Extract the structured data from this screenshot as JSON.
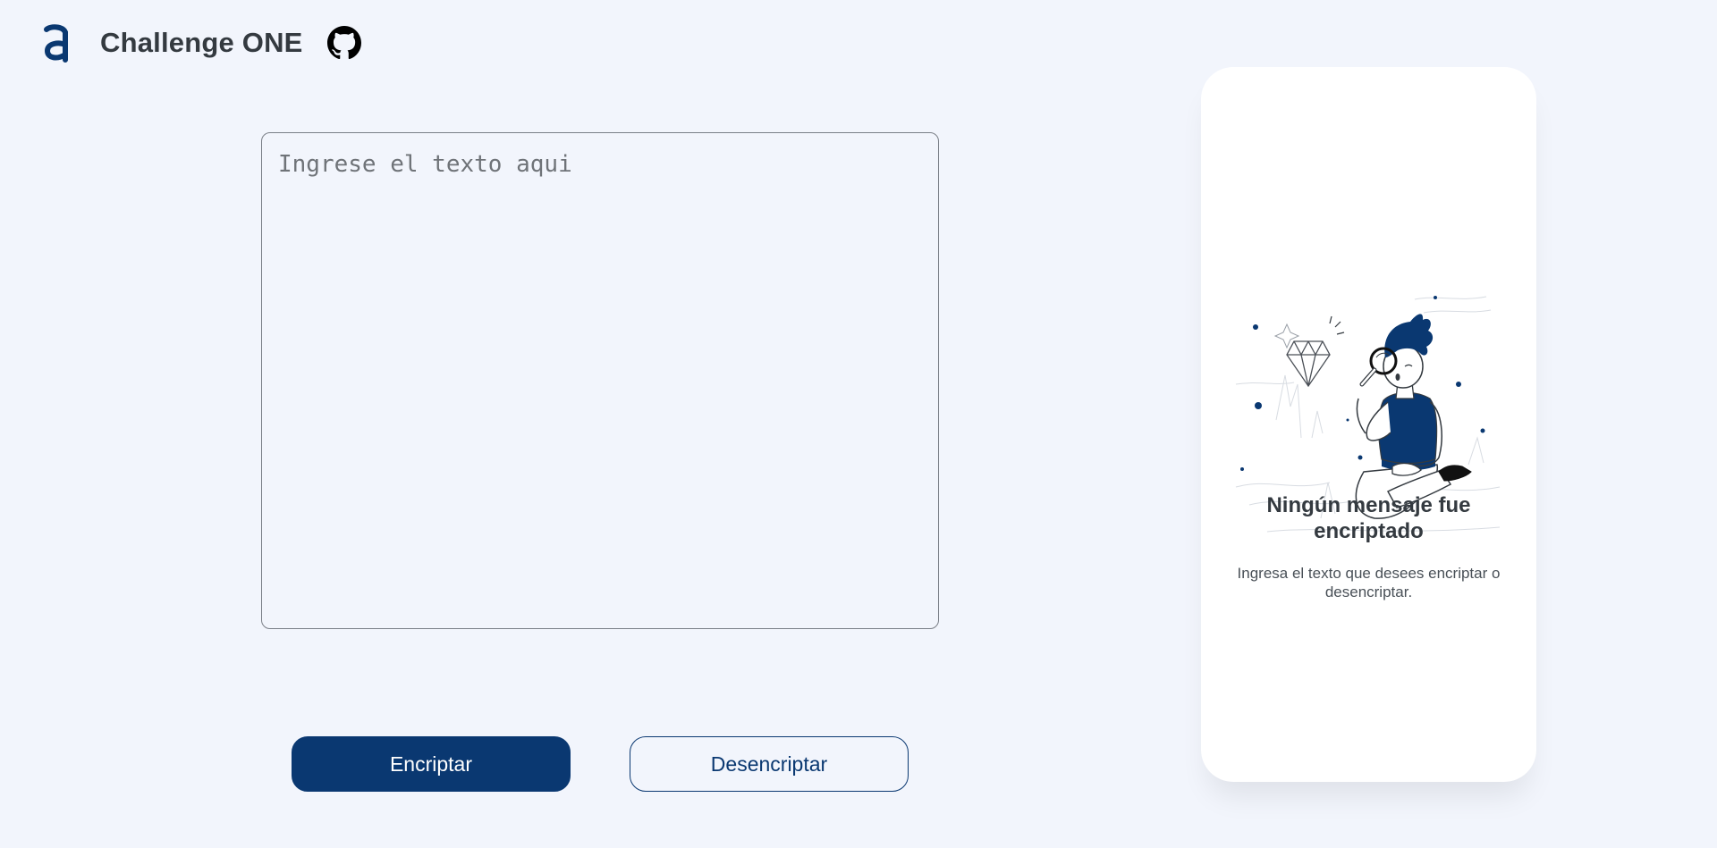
{
  "header": {
    "title": "Challenge ONE",
    "logo_icon": "alura-logo-icon",
    "github_icon": "github-icon"
  },
  "input": {
    "placeholder": "Ingrese el texto aqui",
    "value": ""
  },
  "actions": {
    "encrypt_label": "Encriptar",
    "decrypt_label": "Desencriptar"
  },
  "result_panel": {
    "illustration_icon": "person-with-magnifier-illustration",
    "title": "Ningún mensaje fue encriptado",
    "message": "Ingresa el texto que desees encriptar o desencriptar."
  },
  "colors": {
    "background": "#f2f5fc",
    "primary": "#0a3871",
    "text_dark": "#343a40",
    "card_background": "#ffffff"
  }
}
